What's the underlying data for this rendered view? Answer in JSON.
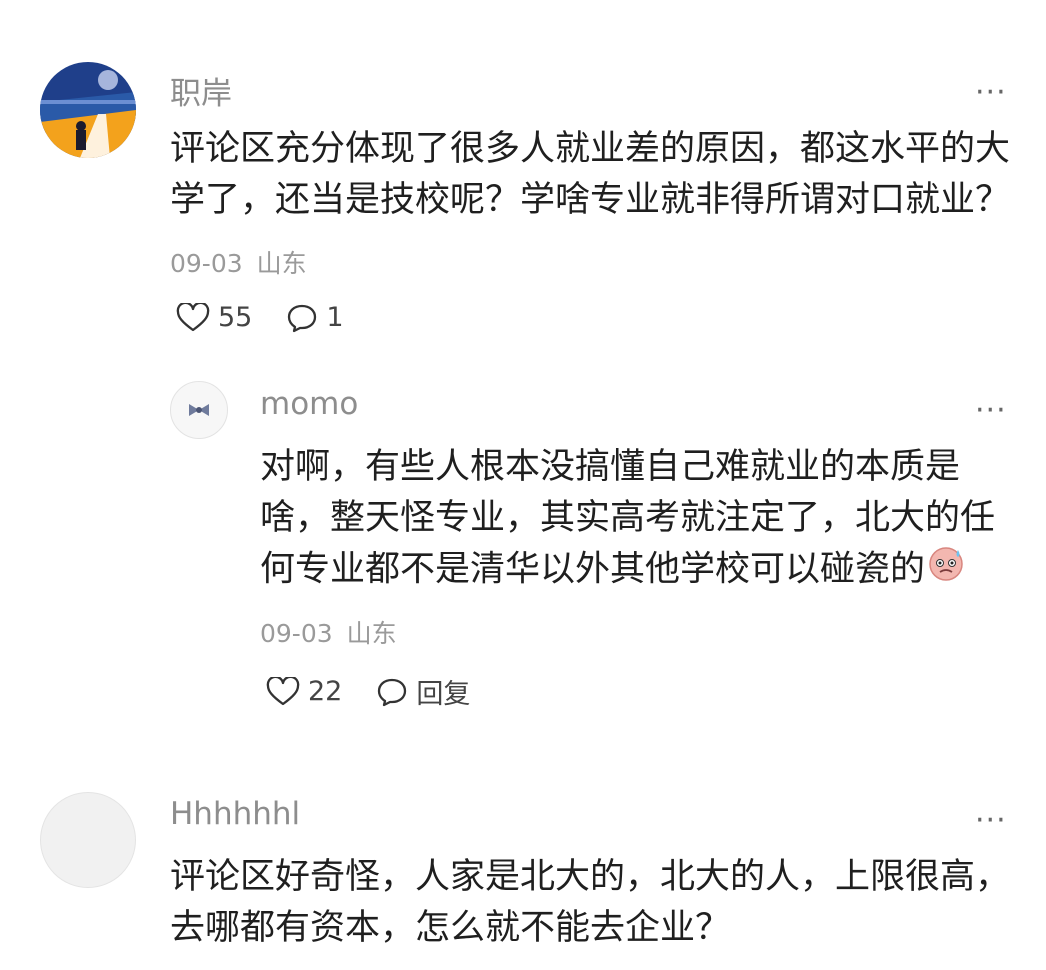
{
  "comments": [
    {
      "username": "职岸",
      "text": "评论区充分体现了很多人就业差的原因，都这水平的大学了，还当是技校呢？学啥专业就非得所谓对口就业？",
      "date": "09-03",
      "location": "山东",
      "likes": "55",
      "replies": "1",
      "more": "···"
    },
    {
      "username": "momo",
      "text": "对啊，有些人根本没搞懂自己难就业的本质是啥，整天怪专业，其实高考就注定了，北大的任何专业都不是清华以外其他学校可以碰瓷的",
      "emoji": "sweat-face-emoji",
      "date": "09-03",
      "location": "山东",
      "likes": "22",
      "reply_label": "回复",
      "more": "···"
    },
    {
      "username": "Hhhhhhl",
      "text": "评论区好奇怪，人家是北大的，北大的人，上限很高，去哪都有资本，怎么就不能去企业？",
      "more": "···"
    }
  ],
  "icons": {
    "like": "heart-outline-icon",
    "comment": "speech-bubble-icon",
    "more": "more-dots-icon"
  },
  "colors": {
    "username": "#8d8d8d",
    "meta": "#9a9a9a",
    "text": "#1f1f1f"
  }
}
